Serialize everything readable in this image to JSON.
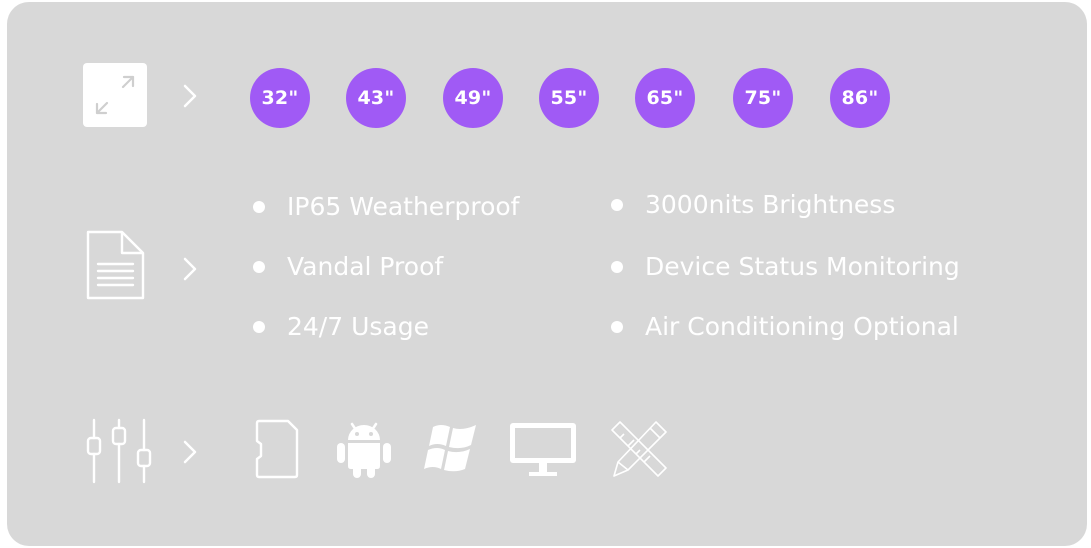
{
  "sizes": {
    "items": [
      "32\"",
      "43\"",
      "49\"",
      "55\"",
      "65\"",
      "75\"",
      "86\""
    ],
    "badge_color": "#a05af5"
  },
  "features": {
    "left": [
      "IP65 Weatherproof",
      "Vandal Proof",
      "24/7 Usage"
    ],
    "right": [
      "3000nits Brightness",
      "Device Status Monitoring",
      "Air Conditioning Optional"
    ]
  },
  "icons": {
    "size_row": "resize-icon",
    "feature_row": "document-icon",
    "spec_row": "sliders-icon",
    "platforms": [
      "sd-card-icon",
      "android-icon",
      "windows-icon",
      "monitor-icon",
      "design-tools-icon"
    ]
  },
  "colors": {
    "panel": "#d8d8d8",
    "text": "#ffffff"
  }
}
